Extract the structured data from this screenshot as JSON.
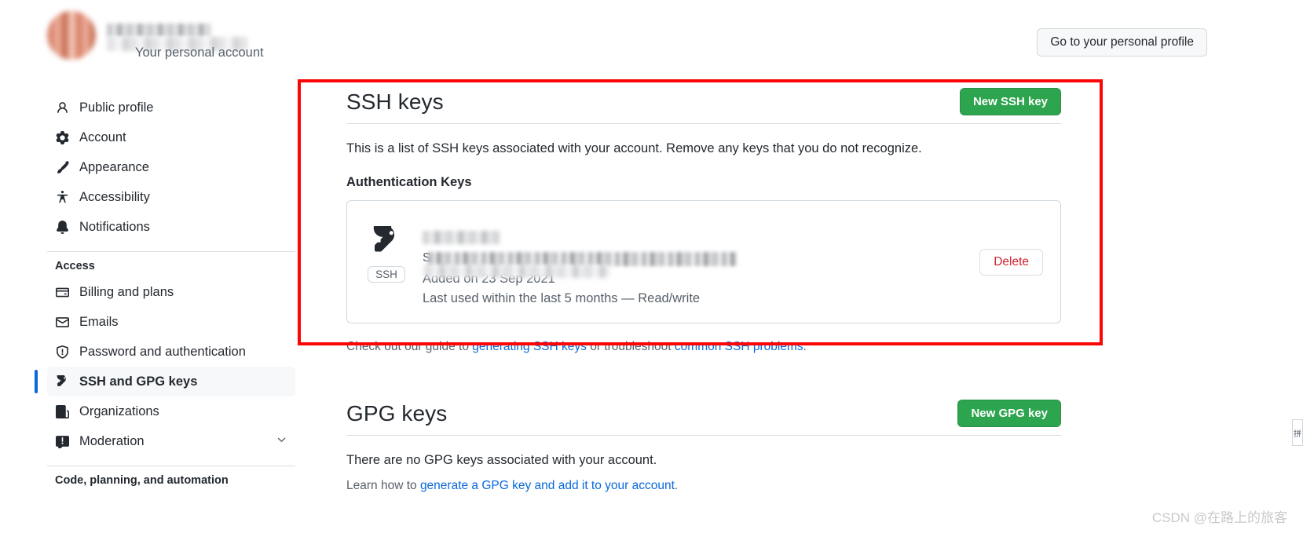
{
  "header": {
    "account_subtitle": "Your personal account",
    "profile_button": "Go to your personal profile"
  },
  "sidebar": {
    "items": [
      {
        "label": "Public profile",
        "icon": "person-icon",
        "active": false
      },
      {
        "label": "Account",
        "icon": "gear-icon",
        "active": false
      },
      {
        "label": "Appearance",
        "icon": "paintbrush-icon",
        "active": false
      },
      {
        "label": "Accessibility",
        "icon": "accessibility-icon",
        "active": false
      },
      {
        "label": "Notifications",
        "icon": "bell-icon",
        "active": false
      }
    ],
    "access_group_title": "Access",
    "access_items": [
      {
        "label": "Billing and plans",
        "icon": "credit-card-icon",
        "active": false
      },
      {
        "label": "Emails",
        "icon": "mail-icon",
        "active": false
      },
      {
        "label": "Password and authentication",
        "icon": "shield-check-icon",
        "active": false
      },
      {
        "label": "SSH and GPG keys",
        "icon": "key-icon",
        "active": true
      },
      {
        "label": "Organizations",
        "icon": "organization-icon",
        "active": false
      },
      {
        "label": "Moderation",
        "icon": "comment-alert-icon",
        "active": false,
        "chevron": true
      }
    ],
    "code_group_title": "Code, planning, and automation"
  },
  "ssh_section": {
    "title": "SSH keys",
    "new_key_button": "New SSH key",
    "description": "This is a list of SSH keys associated with your account. Remove any keys that you do not recognize.",
    "subhead": "Authentication Keys",
    "key": {
      "badge": "SSH",
      "title_redacted": true,
      "fingerprint_prefix": "S",
      "fingerprint_redacted": true,
      "added_on": "Added on 23 Sep 2021",
      "last_used": "Last used within the last 5 months — Read/write",
      "delete_button": "Delete"
    },
    "guide_prefix": "Check out our guide to ",
    "guide_link_1": "generating SSH keys",
    "guide_middle": " or troubleshoot ",
    "guide_link_2": "common SSH problems",
    "guide_suffix": "."
  },
  "gpg_section": {
    "title": "GPG keys",
    "new_key_button": "New GPG key",
    "empty_state": "There are no GPG keys associated with your account.",
    "learn_prefix": "Learn how to ",
    "learn_link": "generate a GPG key and add it to your account",
    "learn_suffix": "."
  },
  "watermark": "CSDN @在路上的旅客",
  "colors": {
    "accent_green": "#2da44e",
    "link_blue": "#0969da",
    "danger_red": "#cf222e",
    "annotation_red": "#fb0505",
    "active_bar": "#0969da"
  }
}
